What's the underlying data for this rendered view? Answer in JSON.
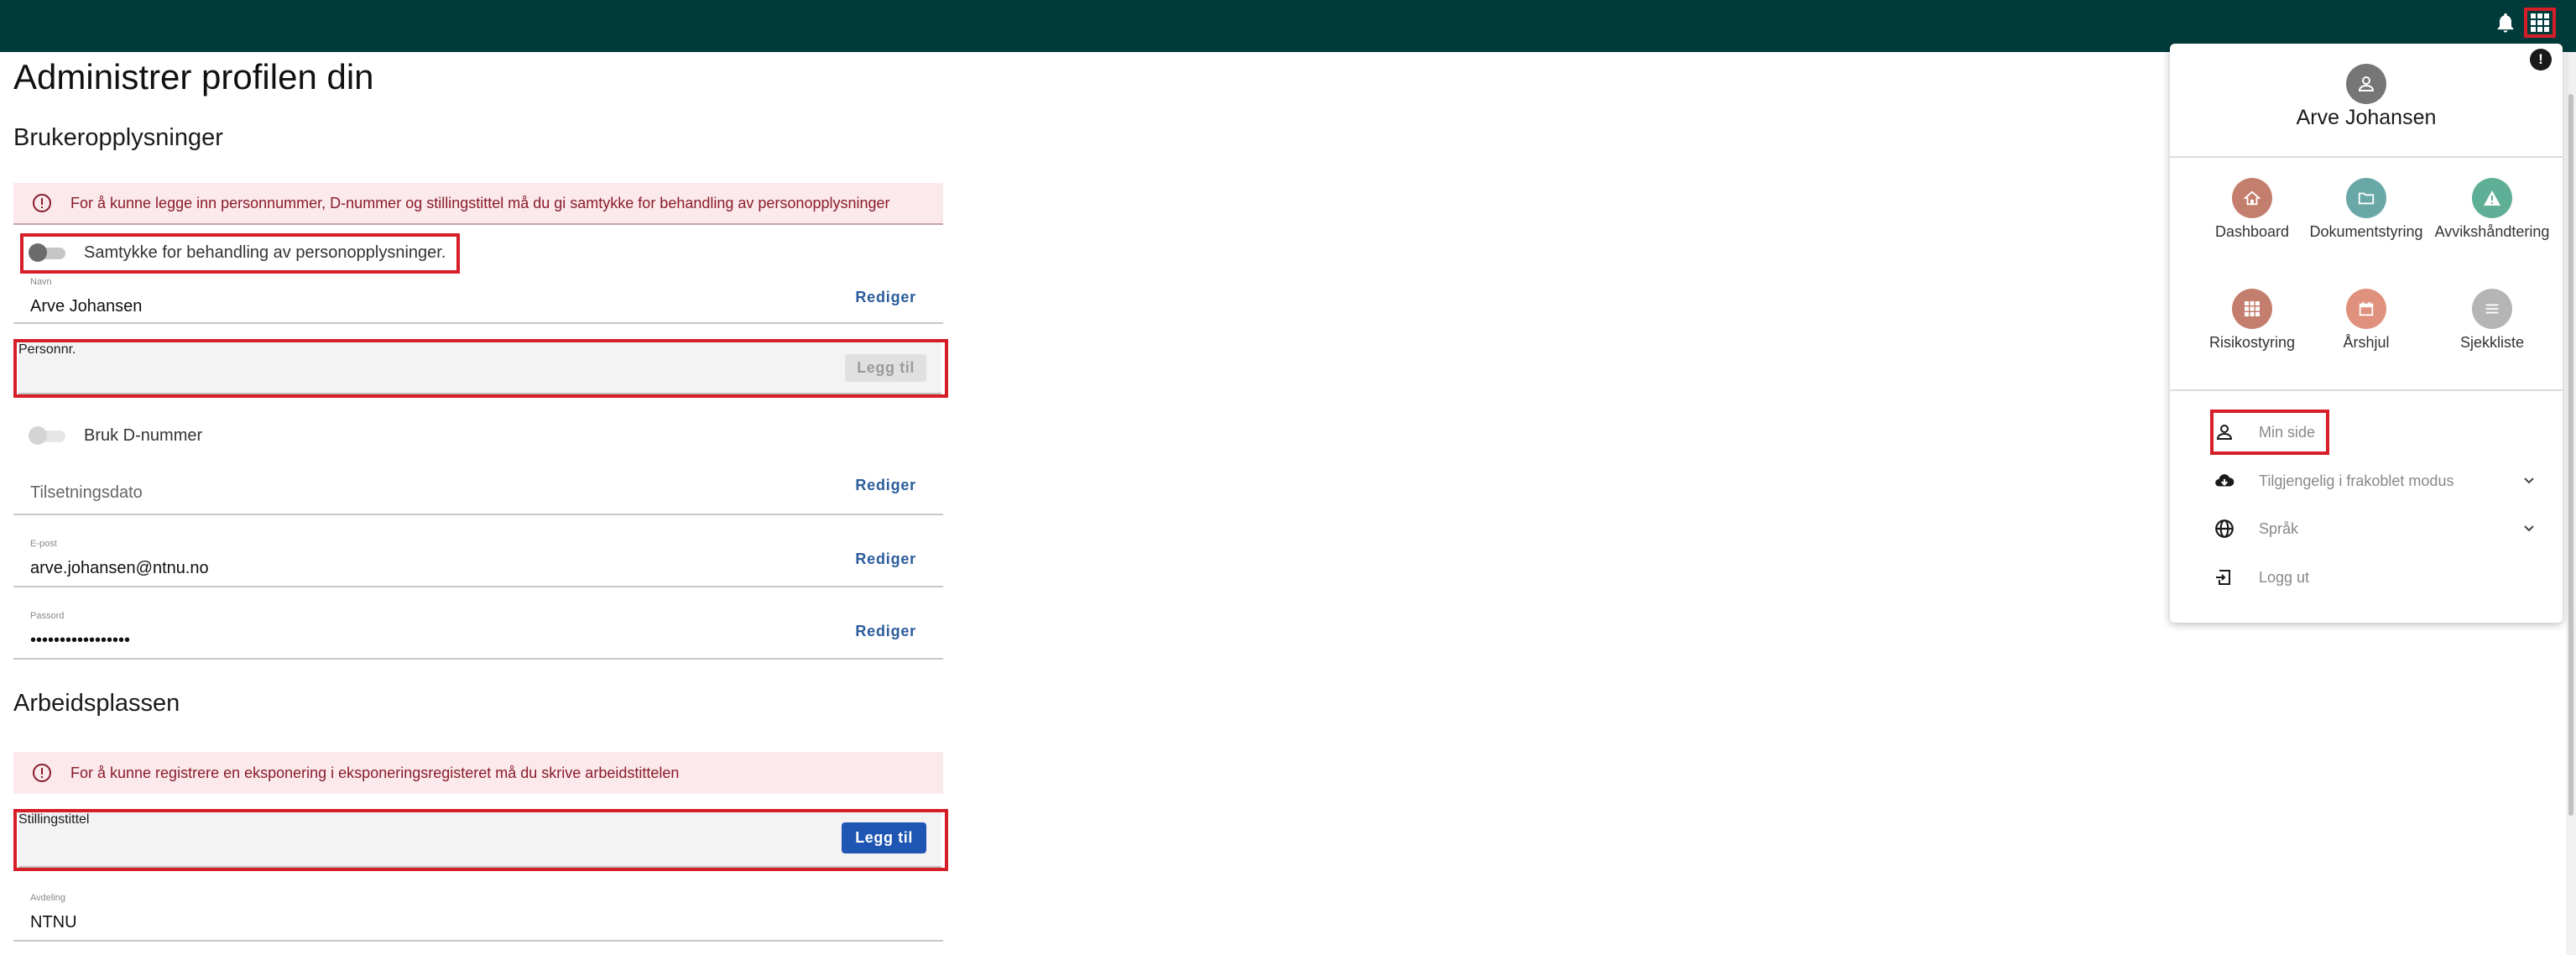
{
  "page": {
    "title": "Administrer profilen din"
  },
  "user_info": {
    "section_title": "Brukeropplysninger",
    "consent_alert": "For å kunne legge inn personnummer, D-nummer og stillingstittel må du gi samtykke for behandling av personopplysninger",
    "consent_toggle_label": "Samtykke for behandling av personopplysninger.",
    "name_label": "Navn",
    "name_value": "Arve Johansen",
    "edit_label": "Rediger",
    "personnr_placeholder": "Personnr.",
    "add_label": "Legg til",
    "dnummer_toggle_label": "Bruk D-nummer",
    "hire_date_placeholder": "Tilsetningsdato",
    "email_label": "E-post",
    "email_value": "arve.johansen@ntnu.no",
    "password_label": "Passord",
    "password_value": "•••••••••••••••••"
  },
  "workplace": {
    "section_title": "Arbeidsplassen",
    "alert": "For å kunne registrere en eksponering i eksponeringsregisteret må du skrive arbeidstittelen",
    "job_title_placeholder": "Stillingstittel",
    "add_label": "Legg til",
    "department_label": "Avdeling",
    "department_value": "NTNU"
  },
  "topbar": {
    "icons": [
      "bell-icon",
      "apps-grid-icon"
    ],
    "badge": "!"
  },
  "user_menu": {
    "user_name": "Arve Johansen",
    "apps": [
      {
        "label": "Dashboard",
        "icon": "home-icon",
        "color": "#c47e6d"
      },
      {
        "label": "Dokumentstyring",
        "icon": "folder-icon",
        "color": "#6aa8a8"
      },
      {
        "label": "Avvikshåndtering",
        "icon": "warning-icon",
        "color": "#5fae96"
      },
      {
        "label": "Risikostyring",
        "icon": "grid-icon",
        "color": "#c47e6d"
      },
      {
        "label": "Årshjul",
        "icon": "calendar-icon",
        "color": "#e0917d"
      },
      {
        "label": "Sjekkliste",
        "icon": "list-icon",
        "color": "#b5b5b5"
      }
    ],
    "items": [
      {
        "label": "Min side",
        "icon": "person-icon"
      },
      {
        "label": "Tilgjengelig i frakoblet modus",
        "icon": "cloud-download-icon"
      },
      {
        "label": "Språk",
        "icon": "globe-icon"
      },
      {
        "label": "Logg ut",
        "icon": "logout-icon"
      }
    ]
  },
  "colors": {
    "topbar": "#003b3b",
    "highlight": "#d61e29",
    "link": "#2b5c9c",
    "primary_button": "#1f56b3",
    "alert_bg": "#fbe9ec",
    "alert_text": "#8a1c2b"
  }
}
